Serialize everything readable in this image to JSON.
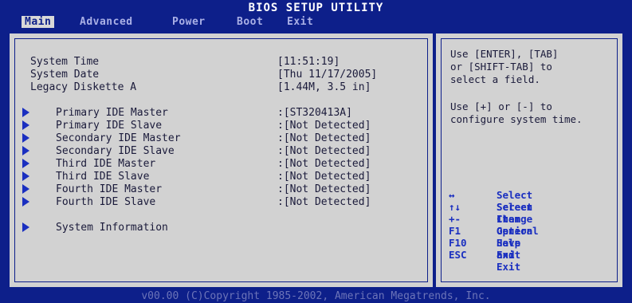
{
  "header": {
    "title": "BIOS SETUP UTILITY",
    "tabs": [
      {
        "label": "Main",
        "active": true
      },
      {
        "label": "Advanced",
        "active": false
      },
      {
        "label": "Power",
        "active": false
      },
      {
        "label": "Boot",
        "active": false
      },
      {
        "label": "Exit",
        "active": false
      }
    ]
  },
  "settings": [
    {
      "label": "System Time",
      "value": "[11:51:19]"
    },
    {
      "label": "System Date",
      "value": "[Thu 11/17/2005]"
    },
    {
      "label": "Legacy Diskette A",
      "value": "[1.44M, 3.5 in]"
    }
  ],
  "submenus": [
    {
      "label": "Primary IDE Master",
      "value": ":[ST320413A]"
    },
    {
      "label": "Primary IDE Slave",
      "value": ":[Not Detected]"
    },
    {
      "label": "Secondary IDE Master",
      "value": ":[Not Detected]"
    },
    {
      "label": "Secondary IDE Slave",
      "value": ":[Not Detected]"
    },
    {
      "label": "Third IDE Master",
      "value": ":[Not Detected]"
    },
    {
      "label": "Third IDE Slave",
      "value": ":[Not Detected]"
    },
    {
      "label": "Fourth IDE Master",
      "value": ":[Not Detected]"
    },
    {
      "label": "Fourth IDE Slave",
      "value": ":[Not Detected]"
    }
  ],
  "system_info": {
    "label": "System Information"
  },
  "help": {
    "lines1": [
      "Use [ENTER], [TAB]",
      "or [SHIFT-TAB] to",
      "select a field."
    ],
    "lines2": [
      "Use [+] or [-] to",
      "configure system time."
    ]
  },
  "keys": [
    {
      "key": "↔",
      "desc": "Select Screen"
    },
    {
      "key": "↑↓",
      "desc": "Select Item"
    },
    {
      "key": "+-",
      "desc": "Change Option"
    },
    {
      "key": "F1",
      "desc": "General Help"
    },
    {
      "key": "F10",
      "desc": "Save and Exit"
    },
    {
      "key": "ESC",
      "desc": "Exit"
    }
  ],
  "footer": "v00.00 (C)Copyright 1985-2002, American Megatrends, Inc.",
  "colors": {
    "background": "#0d1f8a",
    "panel": "#d2d2d2",
    "accent": "#1a2fc0"
  }
}
